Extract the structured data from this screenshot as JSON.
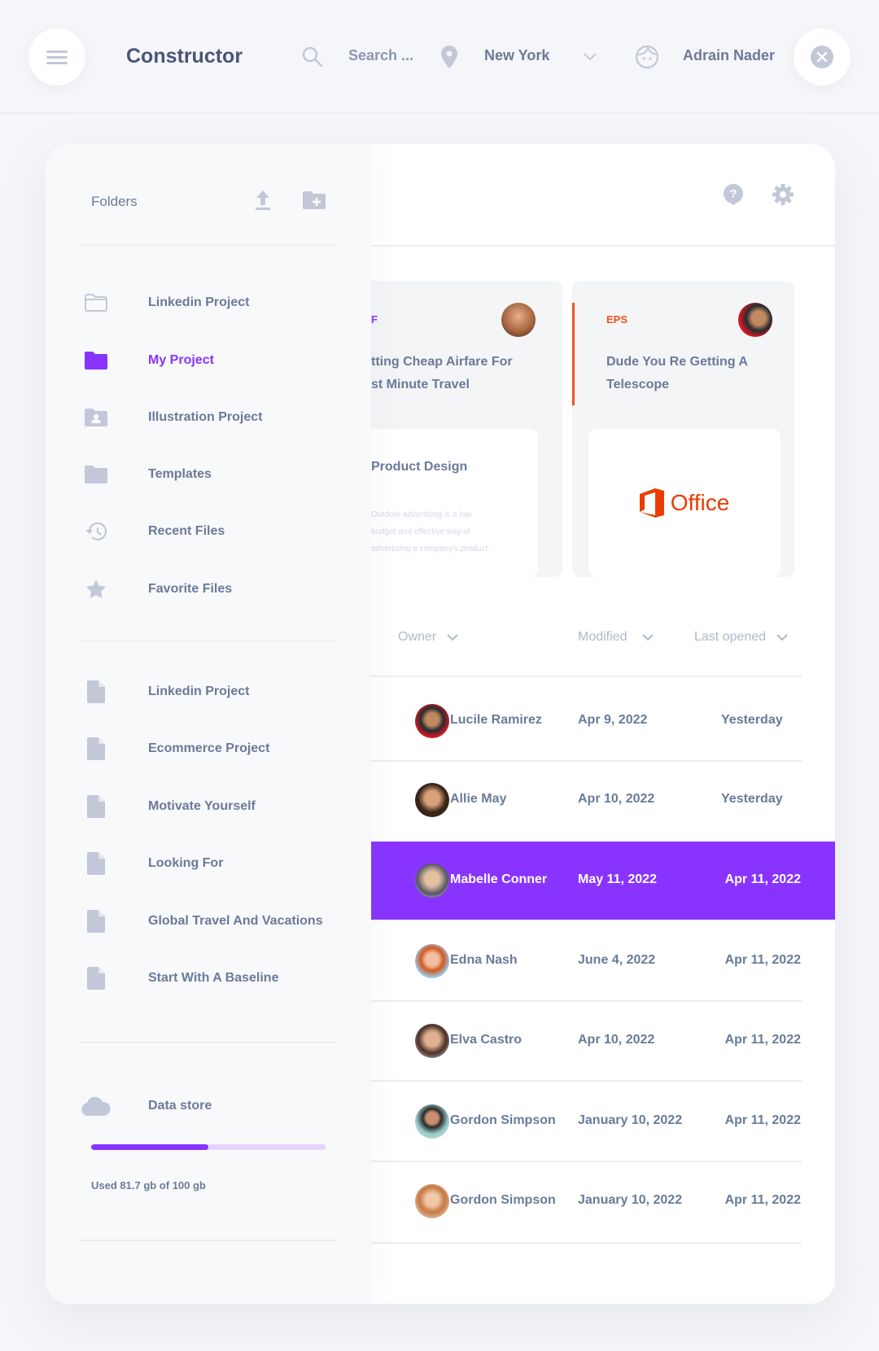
{
  "header": {
    "title": "Constructor",
    "search_placeholder": "Search ...",
    "location": "New York",
    "user": "Adrain Nader"
  },
  "sidebar": {
    "folders_title": "Folders",
    "folders": [
      {
        "label": "Linkedin Project"
      },
      {
        "label": "My Project",
        "active": true
      },
      {
        "label": "Illustration Project"
      },
      {
        "label": "Templates"
      },
      {
        "label": "Recent Files"
      },
      {
        "label": "Favorite Files"
      }
    ],
    "files": [
      {
        "label": "Linkedin Project"
      },
      {
        "label": "Ecommerce Project"
      },
      {
        "label": "Motivate Yourself"
      },
      {
        "label": "Looking For"
      },
      {
        "label": "Global Travel And Vacations"
      },
      {
        "label": "Start With A Baseline"
      }
    ],
    "storage": {
      "label": "Data store",
      "used_text": "Used 81.7 gb of 100 gb",
      "progress_fraction": 0.5
    }
  },
  "cards": [
    {
      "tag": "F",
      "title_line1": "tting Cheap Airfare For",
      "title_line2": "st Minute Travel",
      "inner_title": "Product Design",
      "inner_desc": [
        "Outdoor advertising is a low",
        "budget and effective way of",
        "advertising a company's product."
      ]
    },
    {
      "tag": "EPS",
      "title_line1": "Dude You Re Getting A",
      "title_line2": "Telescope",
      "logo_text": "Office"
    }
  ],
  "table": {
    "headers": {
      "owner": "Owner",
      "modified": "Modified",
      "last_opened": "Last opened"
    },
    "rows": [
      {
        "owner": "Lucile Ramirez",
        "modified": "Apr 9, 2022",
        "last_opened": "Yesterday"
      },
      {
        "owner": "Allie May",
        "modified": "Apr 10, 2022",
        "last_opened": "Yesterday"
      },
      {
        "owner": "Mabelle Conner",
        "modified": "May 11, 2022",
        "last_opened": "Apr 11, 2022",
        "selected": true
      },
      {
        "owner": "Edna Nash",
        "modified": "June 4, 2022",
        "last_opened": "Apr 11, 2022"
      },
      {
        "owner": "Elva Castro",
        "modified": "Apr 10, 2022",
        "last_opened": "Apr 11, 2022"
      },
      {
        "owner": "Gordon Simpson",
        "modified": "January 10, 2022",
        "last_opened": "Apr 11, 2022"
      },
      {
        "owner": "Gordon Simpson",
        "modified": "January 10, 2022",
        "last_opened": "Apr 11, 2022"
      }
    ]
  },
  "colors": {
    "accent": "#8833ff",
    "orange": "#f4511e",
    "text": "#6b7a99",
    "icon": "#c2c8d8"
  }
}
